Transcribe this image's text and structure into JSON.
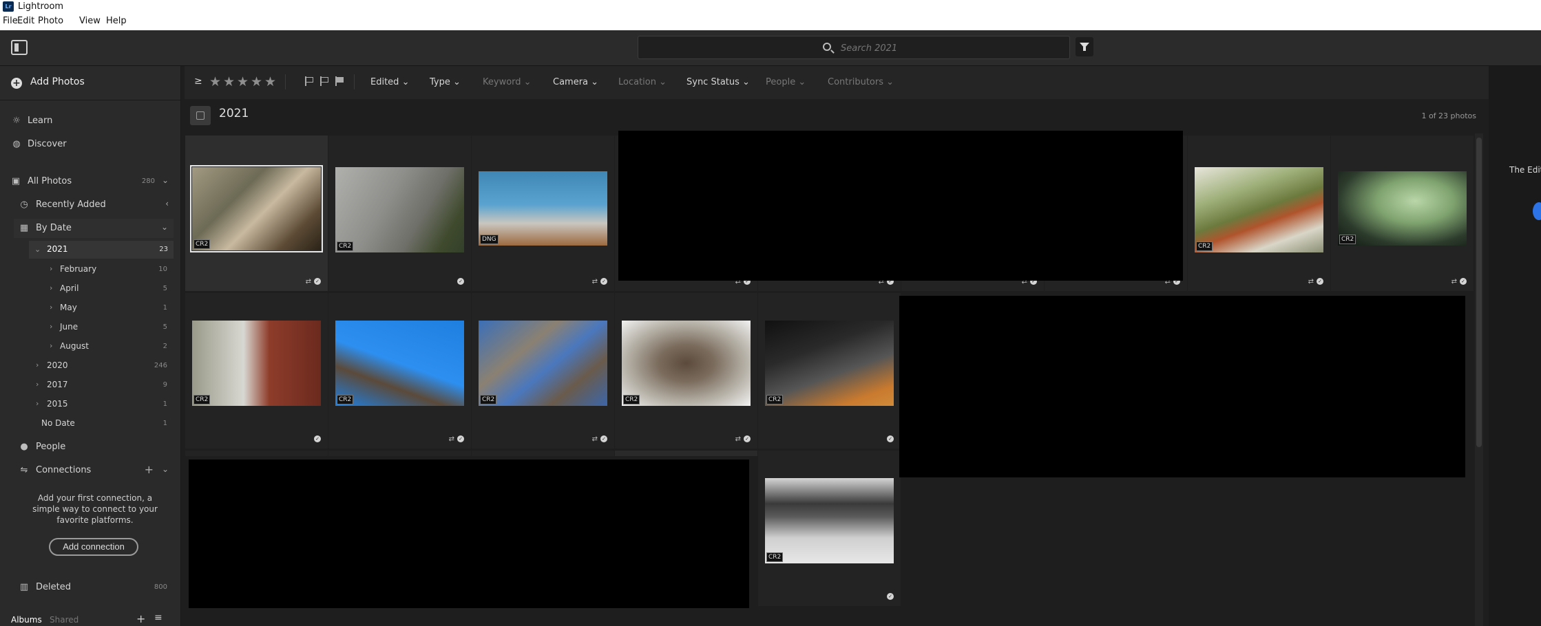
{
  "app": {
    "title": "Lightroom",
    "logo": "Lr"
  },
  "menu": [
    "File",
    "Edit",
    "Photo",
    "View",
    "Help"
  ],
  "search": {
    "placeholder": "Search 2021"
  },
  "sidebar": {
    "add_photos": "Add Photos",
    "learn": "Learn",
    "discover": "Discover",
    "all_photos": {
      "label": "All Photos",
      "count": "280"
    },
    "recently_added": "Recently Added",
    "by_date": "By Date",
    "dates": [
      {
        "label": "2021",
        "count": "23"
      },
      {
        "label": "February",
        "count": "10"
      },
      {
        "label": "April",
        "count": "5"
      },
      {
        "label": "May",
        "count": "1"
      },
      {
        "label": "June",
        "count": "5"
      },
      {
        "label": "August",
        "count": "2"
      },
      {
        "label": "2020",
        "count": "246"
      },
      {
        "label": "2017",
        "count": "9"
      },
      {
        "label": "2015",
        "count": "1"
      },
      {
        "label": "No Date",
        "count": "1"
      }
    ],
    "people": "People",
    "connections": "Connections",
    "connections_text": "Add your first connection, a simple way to connect to your favorite platforms.",
    "add_connection": "Add connection",
    "deleted": {
      "label": "Deleted",
      "count": "800"
    },
    "albums_tab": "Albums",
    "shared_tab": "Shared"
  },
  "toolbar": {
    "rating_op": "≥",
    "filters": [
      "Edited",
      "Type",
      "Keyword",
      "Camera",
      "Location",
      "Sync Status",
      "People",
      "Contributors"
    ]
  },
  "grid": {
    "title": "2021",
    "count_text": "1 of 23 photos"
  },
  "photos": [
    {
      "badge": "CR2"
    },
    {
      "badge": "CR2"
    },
    {
      "badge": "DNG"
    },
    {
      "badge": "CR2"
    },
    {
      "badge": "CR2"
    },
    {
      "badge": "CR2"
    },
    {
      "badge": "CR2"
    },
    {
      "badge": "CR2"
    },
    {
      "badge": "CR2"
    },
    {
      "badge": "CR2"
    },
    {
      "badge": "CR2"
    }
  ],
  "right_panel": {
    "text": "The Edit"
  },
  "colors": {
    "accent": "#2d73e8"
  }
}
